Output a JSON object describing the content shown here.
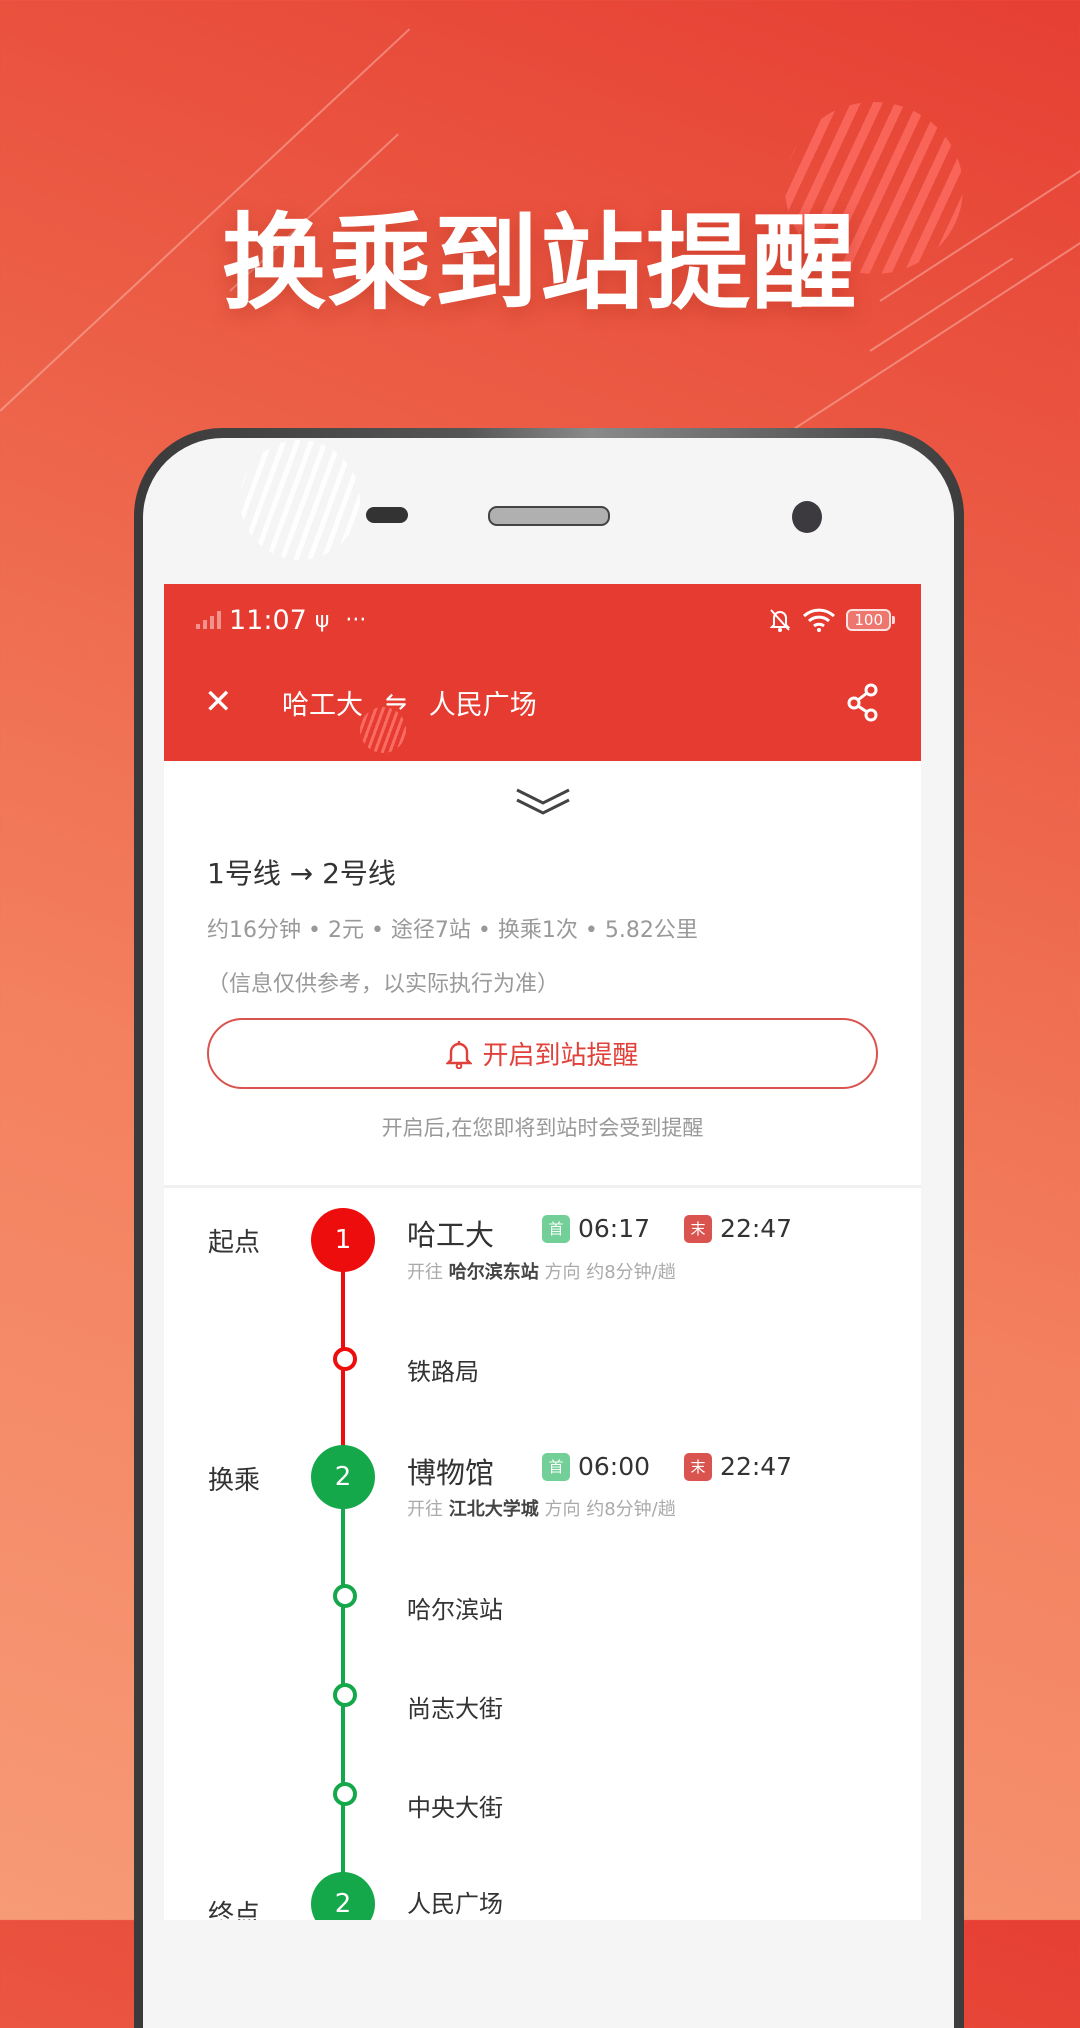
{
  "promo": {
    "title": "换乘到站提醒"
  },
  "colors": {
    "accent": "#e63b31",
    "line1": "#ee0d0d",
    "line2": "#14a84a",
    "first_badge": "#72cf98",
    "last_badge": "#d9534f"
  },
  "status_bar": {
    "time": "11:07",
    "usb_icon": "usb-icon",
    "more": "···",
    "battery": "100"
  },
  "header": {
    "origin": "哈工大",
    "swap_icon": "⇋",
    "destination": "人民广场",
    "close_icon": "✕"
  },
  "summary": {
    "lines": "1号线 → 2号线",
    "stats": "约16分钟 • 2元 • 途径7站 • 换乘1次 •  5.82公里",
    "note": "（信息仅供参考，以实际执行为准）",
    "alert_button": "开启到站提醒",
    "alert_hint": "开启后,在您即将到站时会受到提醒"
  },
  "route": {
    "start": {
      "role": "起点",
      "line": "1",
      "station": "哈工大",
      "first_label": "首",
      "first_time": "06:17",
      "last_label": "末",
      "last_time": "22:47",
      "sub_prefix": "开往",
      "direction": "哈尔滨东站",
      "sub_suffix": "方向 约8分钟/趟"
    },
    "stops_line1": [
      "铁路局"
    ],
    "transfer": {
      "role": "换乘",
      "line": "2",
      "station": "博物馆",
      "first_label": "首",
      "first_time": "06:00",
      "last_label": "末",
      "last_time": "22:47",
      "sub_prefix": "开往",
      "direction": "江北大学城",
      "sub_suffix": "方向 约8分钟/趟"
    },
    "stops_line2": [
      "哈尔滨站",
      "尚志大街",
      "中央大街"
    ],
    "end": {
      "role": "终点",
      "line": "2",
      "station": "人民广场"
    }
  }
}
